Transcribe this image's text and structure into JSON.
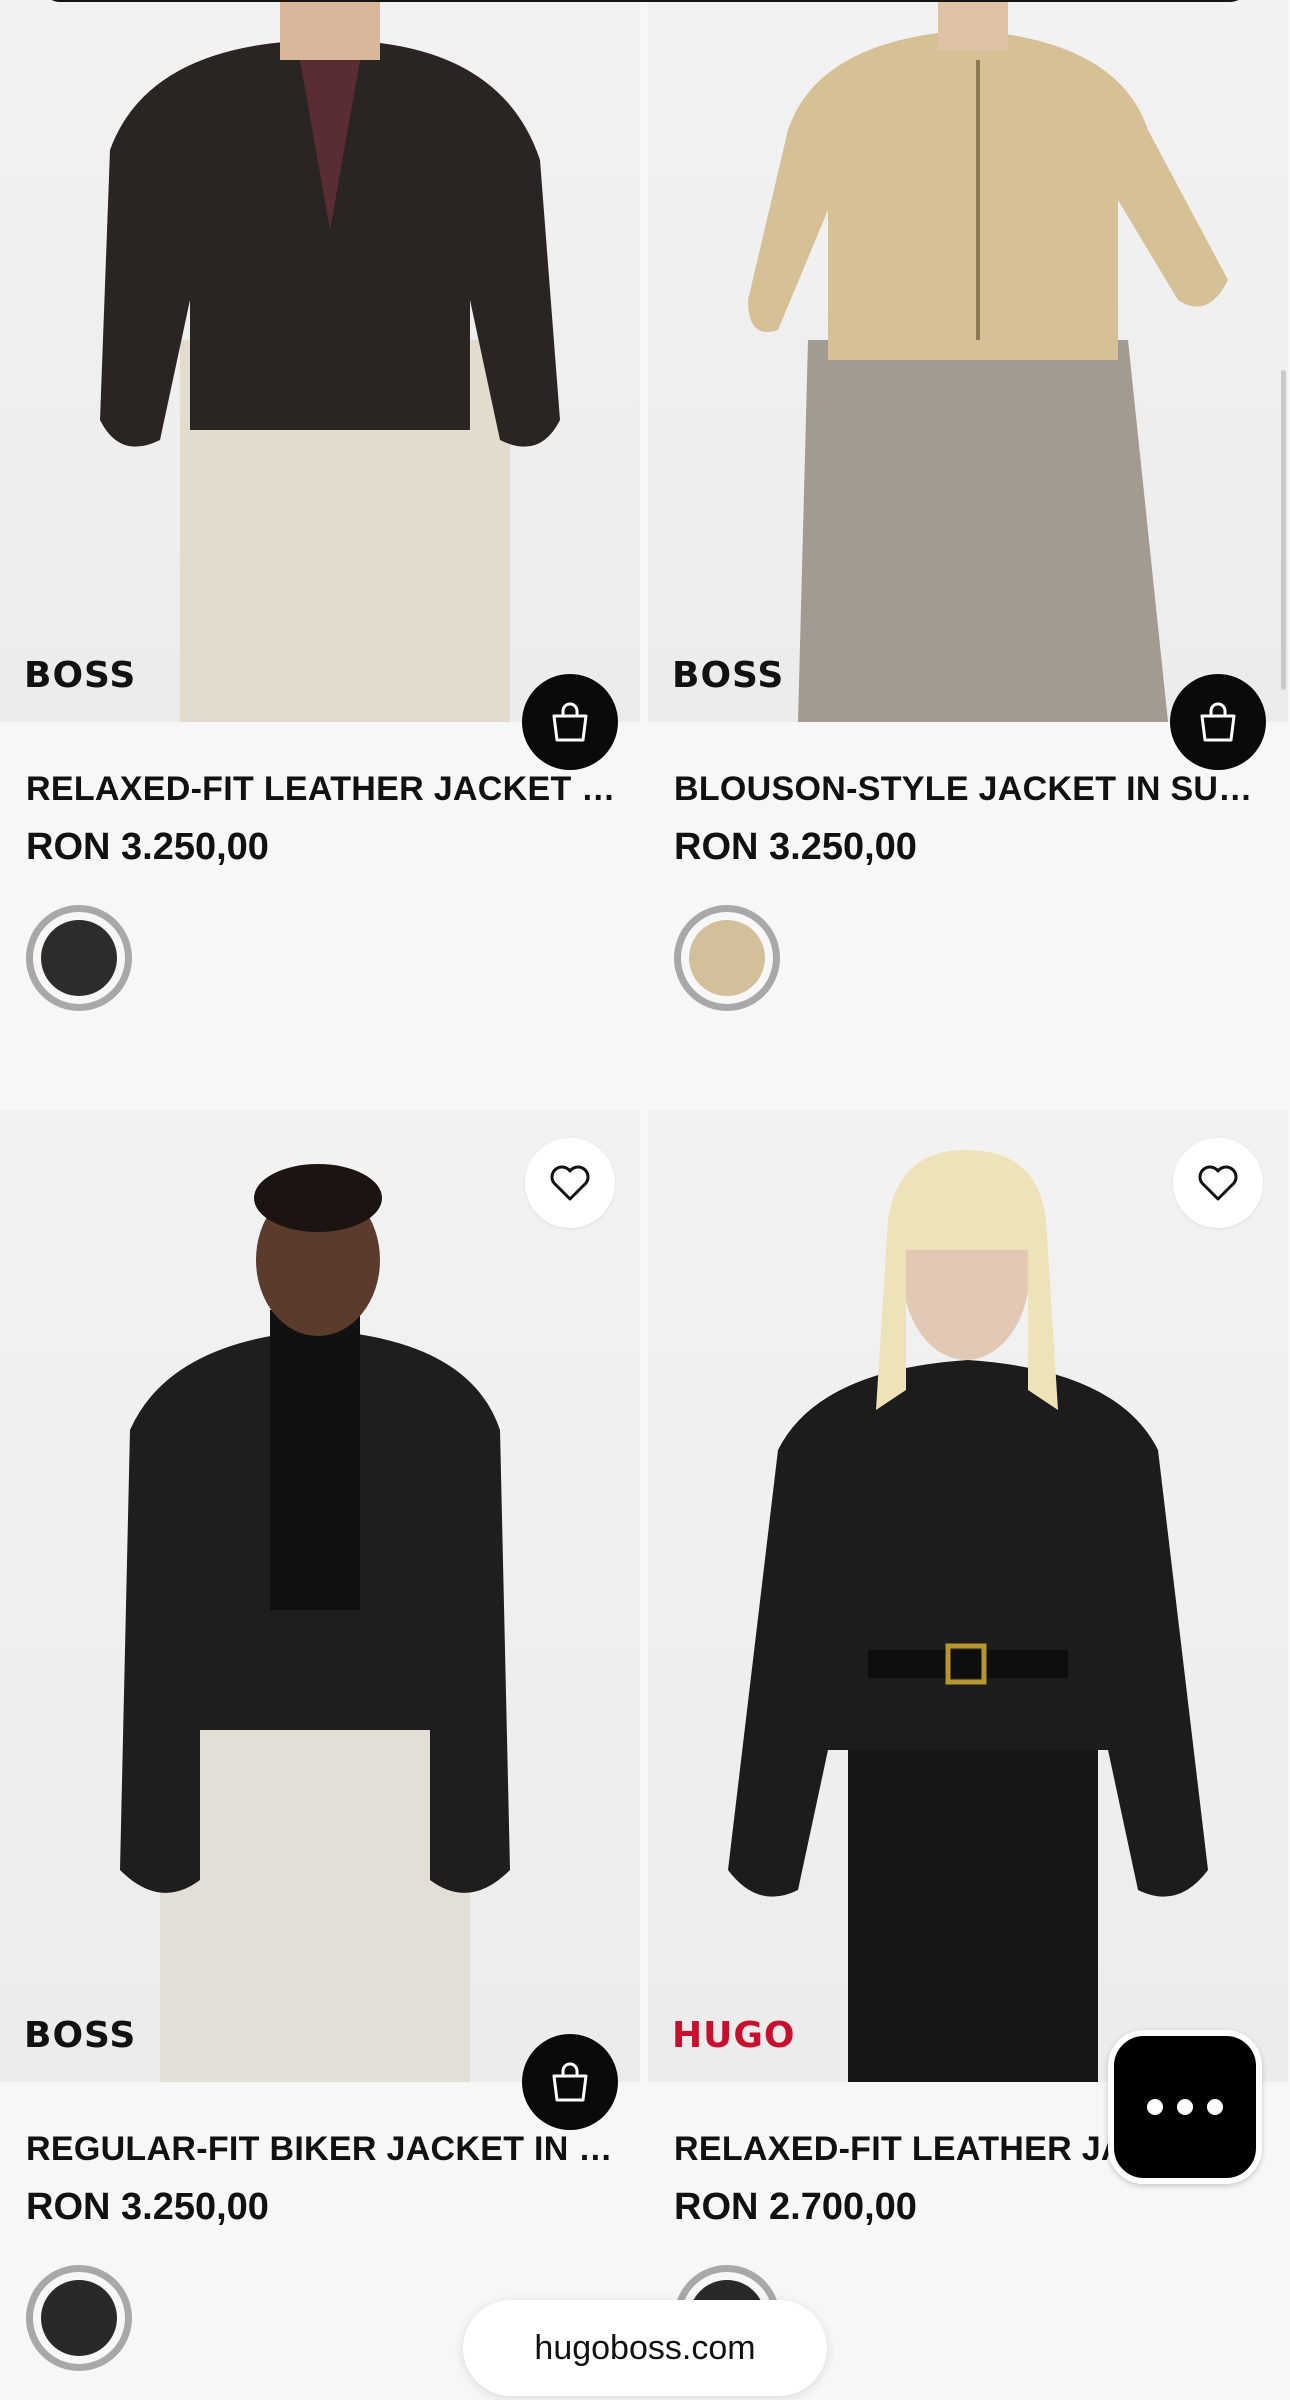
{
  "products": [
    {
      "brand": "BOSS",
      "title": "RELAXED-FIT LEATHER JACKET WITH BUTTON CLOSURE",
      "price": "RON 3.250,00",
      "swatch_color": "#2e2b2b"
    },
    {
      "brand": "BOSS",
      "title": "BLOUSON-STYLE JACKET IN SUEDE",
      "price": "RON 3.250,00",
      "swatch_color": "#d2c09b"
    },
    {
      "brand": "BOSS",
      "title": "REGULAR-FIT BIKER JACKET IN LEATHER",
      "price": "RON 3.250,00",
      "swatch_color": "#2a2929"
    },
    {
      "brand": "HUGO",
      "title": "RELAXED-FIT LEATHER JACKET WITH BELT",
      "price": "RON 2.700,00",
      "swatch_color": "#2a2929"
    }
  ],
  "icons": {
    "bag": "shopping-bag-icon",
    "wishlist": "heart-icon",
    "chat": "chat-dots-icon"
  },
  "browser": {
    "url": "hugoboss.com"
  },
  "colors": {
    "hugo_red": "#c8102e",
    "boss_black": "#111111",
    "background": "#f7f7f7"
  }
}
